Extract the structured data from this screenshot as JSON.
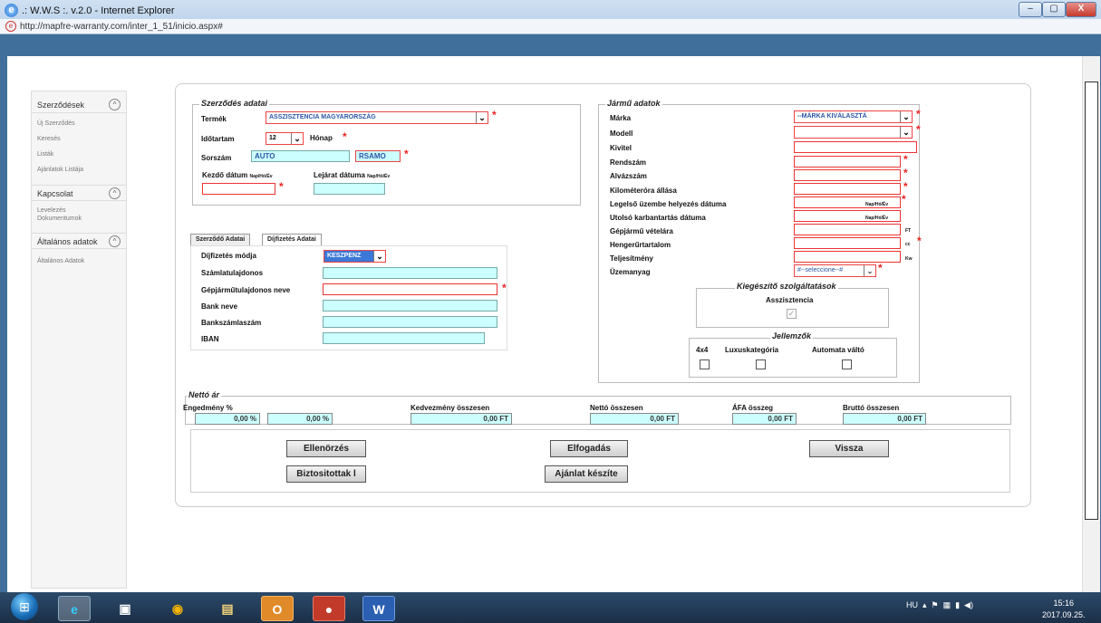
{
  "window": {
    "title": ".: W.W.S :. v.2.0 - Internet Explorer",
    "url": "http://mapfre-warranty.com/inter_1_51/inicio.aspx#",
    "min": "–",
    "max": "▢",
    "close": "X"
  },
  "sidebar": {
    "sections": [
      {
        "label": "Szerződések",
        "icon": "^",
        "items": [
          "Új Szerződés",
          "Keresés",
          "Listák",
          "Ajánlatok Listája"
        ]
      },
      {
        "label": "Kapcsolat",
        "icon": "^",
        "items": [
          "Levelezés",
          "Dokumentumok"
        ]
      },
      {
        "label": "Általános adatok",
        "icon": "^",
        "items": [
          "Általános Adatok"
        ]
      }
    ]
  },
  "contract": {
    "legend": "Szerződés adatai",
    "product_label": "Termék",
    "product_value": "ASSZISZTENCIA MAGYARORSZÁG",
    "duration_label": "Időtartam",
    "duration_value": "12",
    "duration_unit": "Hónap",
    "serial_label": "Sorszám",
    "serial_auto": "AUTO",
    "serial_code": "RSAMO",
    "start_label": "Kezdő dátum",
    "start_fmt": "Nap/Hó/Év",
    "end_label": "Lejárat dátuma",
    "end_fmt": "Nap/Hó/Év"
  },
  "tabs": [
    "Szerződő Adatai",
    "Díjfizetés Adatai"
  ],
  "payment": {
    "method_label": "Díjfizetés módja",
    "method_value": "KESZPENZ",
    "account_owner": "Számlatulajdonos",
    "vehicle_owner": "Gépjárműtulajdonos neve",
    "bank_name": "Bank neve",
    "bank_account": "Bankszámlaszám",
    "iban": "IBAN"
  },
  "vehicle": {
    "legend": "Jármű adatok",
    "brand_label": "Márka",
    "brand_value": "--MÁRKA KIVÁLASZTÁ",
    "model_label": "Modell",
    "trim_label": "Kivitel",
    "plate_label": "Rendszám",
    "chassis_label": "Alvázszám",
    "odo_label": "Kilométeróra állása",
    "first_reg_label": "Legelső üzembe helyezés dátuma",
    "first_reg_fmt": "Nap/Hó/Év",
    "last_service_label": "Utolsó karbantartás dátuma",
    "last_service_fmt": "Nap/Hó/Év",
    "price_label": "Gépjármű vételára",
    "price_unit": "FT",
    "cc_label": "Hengerűrtartalom",
    "cc_unit": "cc",
    "power_label": "Teljesítmény",
    "power_unit": "Kw",
    "fuel_label": "Üzemanyag",
    "fuel_value": "#--seleccione--#"
  },
  "extras": {
    "legend": "Kiegészítő szolgáltatások",
    "assistance": "Asszisztencia",
    "assistance_mark": "✓"
  },
  "features": {
    "legend": "Jellemzők",
    "f4x4": "4x4",
    "lux": "Luxuskategória",
    "auto": "Automata váltó"
  },
  "net": {
    "legend": "Nettó ár",
    "discount_label": "Engedmény %",
    "discount1": "0,00 %",
    "discount2": "0,00 %",
    "disc_total_label": "Kedvezmény összesen",
    "disc_total": "0,00 FT",
    "net_total_label": "Nettó összesen",
    "net_total": "0,00 FT",
    "vat_label": "ÁFA összeg",
    "vat": "0,00 FT",
    "gross_label": "Bruttó összesen",
    "gross": "0,00 FT"
  },
  "buttons": {
    "check": "Ellenörzés",
    "accept": "Elfogadás",
    "back": "Vissza",
    "insured": "Biztositottak l",
    "offer": "Ajánlat készíte"
  },
  "taskbar": {
    "lang": "HU",
    "time": "15:16",
    "date": "2017.09.25."
  }
}
